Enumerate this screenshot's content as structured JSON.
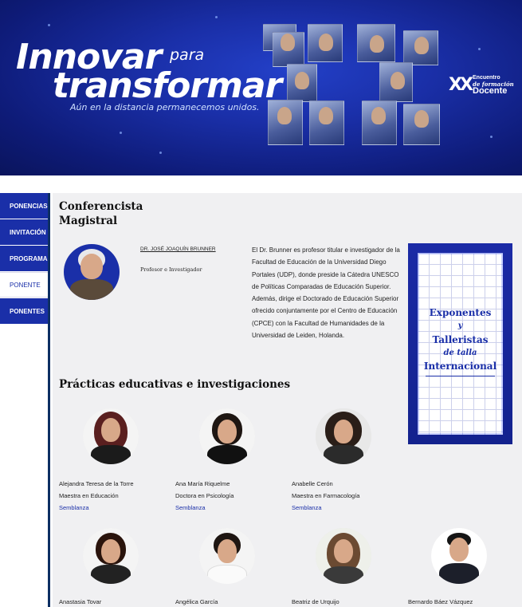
{
  "banner": {
    "headline_line1": "Innovar",
    "headline_small": "para",
    "headline_line2": "transformar",
    "tagline": "Aún en la distancia   permanecemos unidos.",
    "event_mark": "XX",
    "event_line1": "Encuentro",
    "event_line2": "de formación",
    "event_line3": "Docente"
  },
  "sidebar": {
    "items": [
      {
        "label": "PONENCIAS"
      },
      {
        "label": "INVITACIÓN"
      },
      {
        "label": "PROGRAMA"
      },
      {
        "label": "PONENTE"
      },
      {
        "label": "PONENTES"
      }
    ]
  },
  "keynote": {
    "title": "Conferencista Magistral",
    "name": "DR. JOSÉ JOAQUÍN BRUNNER",
    "role": "Profesor e Investigador",
    "bio": "El Dr. Brunner es profesor titular e investigador de la Facultad de Educación de la Universidad Diego Portales (UDP), donde preside la Cátedra UNESCO de Políticas Comparadas de Educación Superior. Además, dirige el Doctorado de Educación Superior ofrecido conjuntamente por el Centro de Educación (CPCE) con la Facultad de Humanidades de la Universidad de Leiden, Holanda."
  },
  "promo": {
    "line1": "Exponentes",
    "line2": "y",
    "line3": "Talleristas",
    "line4": "de talla",
    "line5": "Internacional"
  },
  "practices": {
    "title": "Prácticas educativas e investigaciones",
    "people": [
      {
        "name": "Alejandra Teresa de la Torre",
        "degree": "Maestra en Educación",
        "link": "Semblanza"
      },
      {
        "name": "Ana María Riquelme",
        "degree": "Doctora en Psicología",
        "link": "Semblanza"
      },
      {
        "name": "Anabelle Cerón",
        "degree": "Maestra en Farmacología",
        "link": "Semblanza"
      },
      {
        "name": "Anastasia Tovar",
        "degree": "",
        "link": ""
      },
      {
        "name": "Angélica García",
        "degree": "",
        "link": ""
      },
      {
        "name": "Beatriz de Urquijo",
        "degree": "",
        "link": ""
      },
      {
        "name": "Bernardo Báez Vázquez",
        "degree": "",
        "link": ""
      }
    ]
  },
  "colors": {
    "brand_blue": "#1a2fa8",
    "sidebar_border": "#0d2f63",
    "content_bg": "#f0f0f2"
  }
}
